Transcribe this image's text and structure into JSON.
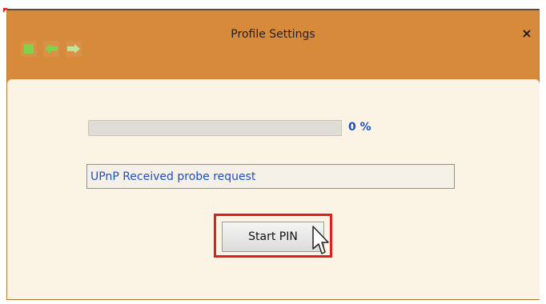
{
  "window": {
    "title": "Profile Settings",
    "close_symbol": "×"
  },
  "toolbar": {
    "icons": [
      "stop-icon",
      "back-arrow-icon",
      "forward-arrow-icon"
    ]
  },
  "progress": {
    "fraction": 0.0,
    "label": "0 %"
  },
  "status": {
    "text": "UPnP Received probe request"
  },
  "actions": {
    "start_pin_label": "Start PIN"
  },
  "colors": {
    "frame": "#d88a3b",
    "panel": "#fbf3e3",
    "accent_blue": "#1f4fbf",
    "highlight_red": "#e61b1b",
    "toolbar_green": "#7fd24a"
  }
}
